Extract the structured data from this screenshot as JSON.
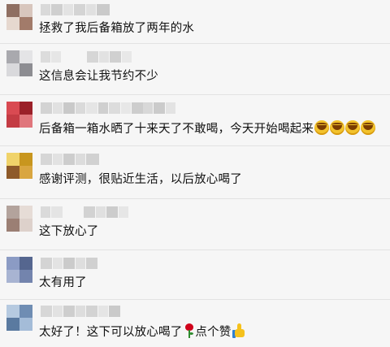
{
  "comments": [
    {
      "text": "拯救了我后备箱放了两年的水"
    },
    {
      "text": "这信息会让我节约不少"
    },
    {
      "text": "后备箱一箱水晒了十来天了不敢喝，今天开始喝起来"
    },
    {
      "text": "感谢评测，很贴近生活，以后放心喝了"
    },
    {
      "text": "这下放心了"
    },
    {
      "text": "太有用了"
    },
    {
      "text": "太好了！这下可以放心喝了",
      "text_after": "点个赞"
    }
  ],
  "icons": {
    "laugh": "laughing-emoji",
    "rose": "rose-emoji",
    "thumb": "thumbs-up-emoji"
  }
}
